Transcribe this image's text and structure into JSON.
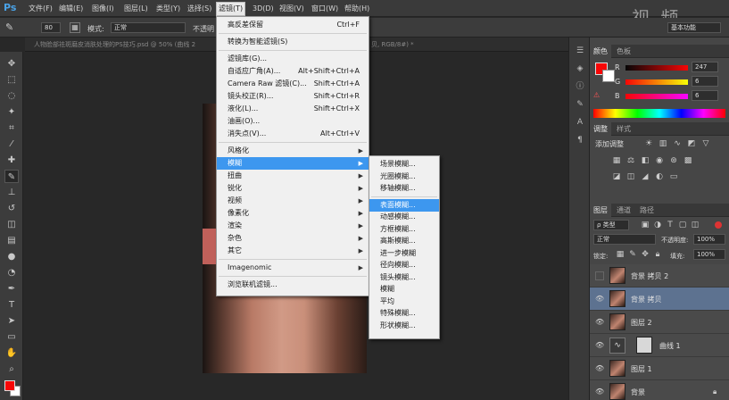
{
  "app": {
    "logo": "Ps"
  },
  "menubar": {
    "items": [
      "文件(F)",
      "编辑(E)",
      "图像(I)",
      "图层(L)",
      "类型(Y)",
      "选择(S)",
      "滤镜(T)",
      "3D(D)",
      "视图(V)",
      "窗口(W)",
      "帮助(H)"
    ],
    "active": "滤镜(T)"
  },
  "watermark": "视 频",
  "options_bar": {
    "brush_size": "80",
    "mode_label": "模式:",
    "mode_value": "正常",
    "opacity_label": "不透明",
    "workspace": "基本功能"
  },
  "document": {
    "tab_title": "人物脸部祛斑磨皮消肤处理的PS技巧.psd @ 50% (曲线 2",
    "tab_title_right": "贝, RGB/8#) *"
  },
  "filter_menu": {
    "items": [
      {
        "label": "高反差保留",
        "shortcut": "Ctrl+F"
      },
      {
        "sep": true
      },
      {
        "label": "转换为智能滤镜(S)"
      },
      {
        "sep": true
      },
      {
        "label": "滤镜库(G)..."
      },
      {
        "label": "自适应广角(A)...",
        "shortcut": "Alt+Shift+Ctrl+A"
      },
      {
        "label": "Camera Raw 滤镜(C)...",
        "shortcut": "Shift+Ctrl+A"
      },
      {
        "label": "镜头校正(R)...",
        "shortcut": "Shift+Ctrl+R"
      },
      {
        "label": "液化(L)...",
        "shortcut": "Shift+Ctrl+X"
      },
      {
        "label": "油画(O)..."
      },
      {
        "label": "消失点(V)...",
        "shortcut": "Alt+Ctrl+V"
      },
      {
        "sep": true
      },
      {
        "label": "风格化",
        "submenu": true
      },
      {
        "label": "模糊",
        "submenu": true,
        "highlight": true
      },
      {
        "label": "扭曲",
        "submenu": true
      },
      {
        "label": "锐化",
        "submenu": true
      },
      {
        "label": "视频",
        "submenu": true
      },
      {
        "label": "像素化",
        "submenu": true
      },
      {
        "label": "渲染",
        "submenu": true
      },
      {
        "label": "杂色",
        "submenu": true
      },
      {
        "label": "其它",
        "submenu": true
      },
      {
        "sep": true
      },
      {
        "label": "Imagenomic",
        "submenu": true
      },
      {
        "sep": true
      },
      {
        "label": "浏览联机滤镜..."
      }
    ]
  },
  "blur_submenu": {
    "items": [
      {
        "label": "场景模糊..."
      },
      {
        "label": "光圈模糊..."
      },
      {
        "label": "移轴模糊..."
      },
      {
        "sep": true
      },
      {
        "label": "表面模糊...",
        "highlight": true
      },
      {
        "label": "动感模糊..."
      },
      {
        "label": "方框模糊..."
      },
      {
        "label": "高斯模糊..."
      },
      {
        "label": "进一步模糊"
      },
      {
        "label": "径向模糊..."
      },
      {
        "label": "镜头模糊..."
      },
      {
        "label": "模糊"
      },
      {
        "label": "平均"
      },
      {
        "label": "特殊模糊..."
      },
      {
        "label": "形状模糊..."
      }
    ]
  },
  "color_panel": {
    "tabs": [
      "颜色",
      "色板"
    ],
    "channels": [
      {
        "label": "R",
        "value": "247"
      },
      {
        "label": "G",
        "value": "6"
      },
      {
        "label": "B",
        "value": "6"
      }
    ],
    "fg_color": "#f70606"
  },
  "adjustments_panel": {
    "tabs": [
      "调整",
      "样式"
    ],
    "title": "添加调整"
  },
  "layers_panel": {
    "tabs": [
      "图层",
      "通道",
      "路径"
    ],
    "kind_label": "ρ 类型",
    "blend_mode": "正常",
    "opacity_label": "不透明度:",
    "opacity_value": "100%",
    "lock_label": "锁定:",
    "fill_label": "填充:",
    "fill_value": "100%",
    "layers": [
      {
        "name": "背景 拷贝 2",
        "visible": false
      },
      {
        "name": "背景 拷贝",
        "visible": true,
        "selected": true
      },
      {
        "name": "图层 2",
        "visible": true
      },
      {
        "name": "曲线 1",
        "visible": true,
        "adjustment": true
      },
      {
        "name": "图层 1",
        "visible": true
      },
      {
        "name": "背景",
        "visible": true,
        "locked": true
      }
    ]
  }
}
